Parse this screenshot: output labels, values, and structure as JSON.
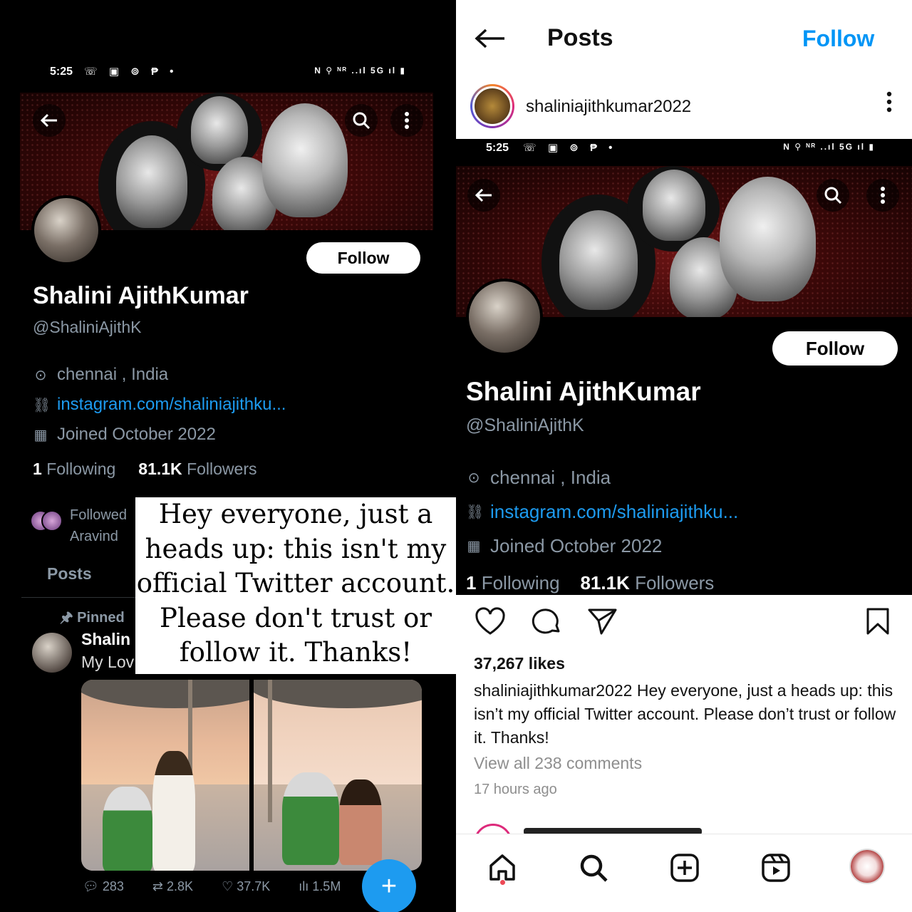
{
  "twitter": {
    "status_time": "5:25",
    "status_left_icons": "☏ ▣ ⊚ ₱ •",
    "status_right_icons": "N ⚲ ᴺᴿ ..ıl 5G ıl ▮",
    "follow_label": "Follow",
    "display_name": "Shalini AjithKumar",
    "handle": "@ShaliniAjithK",
    "location": "chennai , India",
    "link": "instagram.com/shaliniajithku...",
    "joined": "Joined October 2022",
    "following_count": "1",
    "following_label": "Following",
    "followers_count": "81.1K",
    "followers_label": "Followers",
    "followed_by_line1": "Followed",
    "followed_by_line2": "Aravind",
    "tab_posts": "Posts",
    "pinned_label": "Pinned",
    "tweet_name": "Shalin",
    "tweet_text": "My Lov",
    "stats": {
      "replies": "283",
      "retweets": "2.8K",
      "likes": "37.7K",
      "views": "1.5M"
    }
  },
  "note_overlay": {
    "lines": [
      "Hey everyone, just a",
      "heads up: this isn't my",
      "official Twitter account.",
      "Please don't trust or",
      "follow it. Thanks!"
    ]
  },
  "instagram": {
    "header_title": "Posts",
    "header_follow": "Follow",
    "username": "shaliniajithkumar2022",
    "likes": "37,267 likes",
    "caption_user": "shaliniajithkumar2022",
    "caption_text": " Hey everyone, just a heads up: this isn’t my official Twitter account. Please don’t trust or follow it. Thanks!",
    "view_comments": "View all 238 comments",
    "time_ago": "17 hours ago"
  }
}
